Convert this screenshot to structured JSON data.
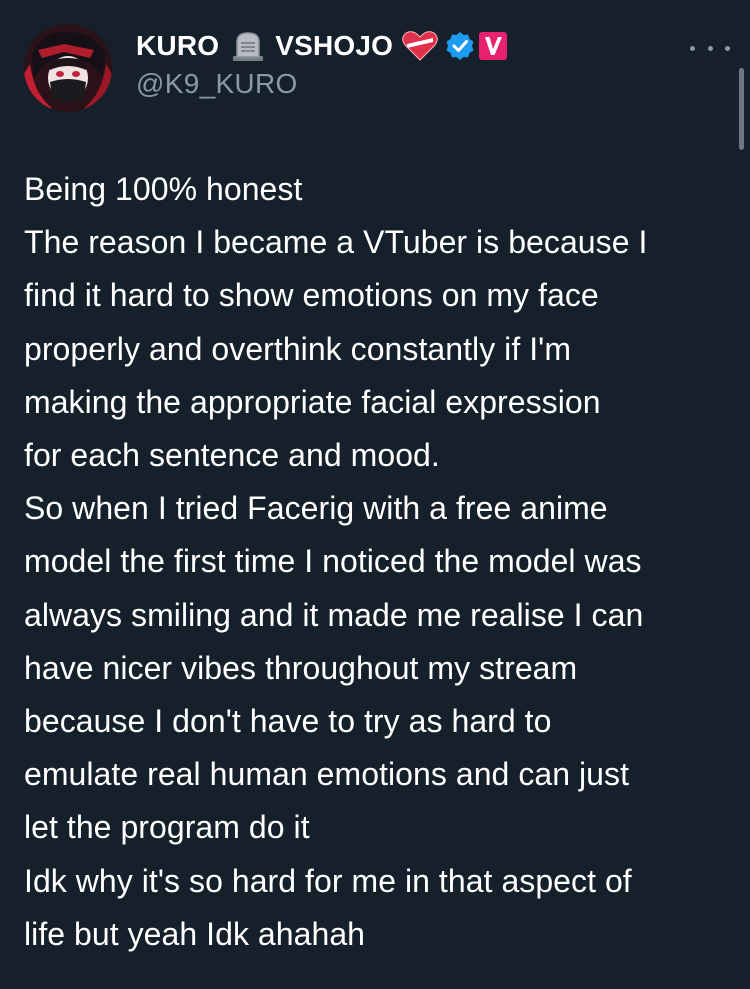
{
  "author": {
    "display_name_part1": "KURO",
    "display_name_part2": "VSHOJO",
    "handle": "@K9_KURO",
    "icons": [
      "tombstone-icon",
      "heart-icon",
      "verified-icon",
      "vshojo-v-badge-icon"
    ],
    "verified_color": "#1d9bf0",
    "badge_color": "#e8216f"
  },
  "tweet": {
    "lines": [
      "Being 100% honest",
      "The reason I became a VTuber is because I",
      "find it hard to show emotions on my face",
      "properly and overthink constantly if I'm",
      "making the appropriate facial expression",
      "for each sentence and mood.",
      "So when I tried Facerig with a free anime",
      "model the first time I noticed the model was",
      "always smiling and it made me realise I can",
      "have nicer vibes throughout my stream",
      "because I don't have to try as hard to",
      "emulate real human emotions and can just",
      "let the program do it",
      "Idk why it's so hard for me in that aspect of",
      "life but yeah Idk ahahah"
    ]
  },
  "colors": {
    "background": "#15202b",
    "text": "#ffffff",
    "muted": "#8b98a5"
  }
}
